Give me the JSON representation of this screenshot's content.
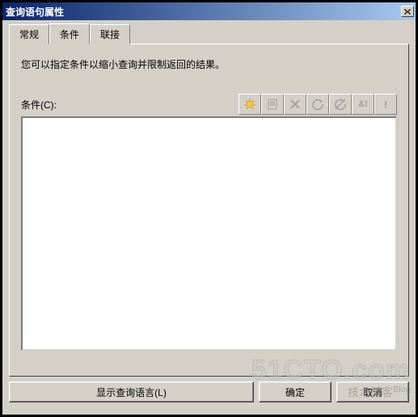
{
  "window": {
    "title": "查询语句属性",
    "close_label": "✕"
  },
  "tabs": {
    "general": "常规",
    "conditions": "条件",
    "joins": "联接",
    "active_index": 1
  },
  "page": {
    "description": "您可以指定条件以缩小查询并限制返回的结果。",
    "conditions_label": "条件(C):"
  },
  "toolbar": {
    "new": "new-star",
    "copy": "copy",
    "delete": "delete",
    "refresh": "refresh",
    "undo": "undo-strike",
    "and": "&!",
    "exclaim": "!"
  },
  "buttons": {
    "show_query": "显示查询语言(L)",
    "ok": "确定",
    "cancel": "取消"
  },
  "watermark": {
    "main": "51CTO.com",
    "sub": "技术博客",
    "blog": "Blog"
  }
}
